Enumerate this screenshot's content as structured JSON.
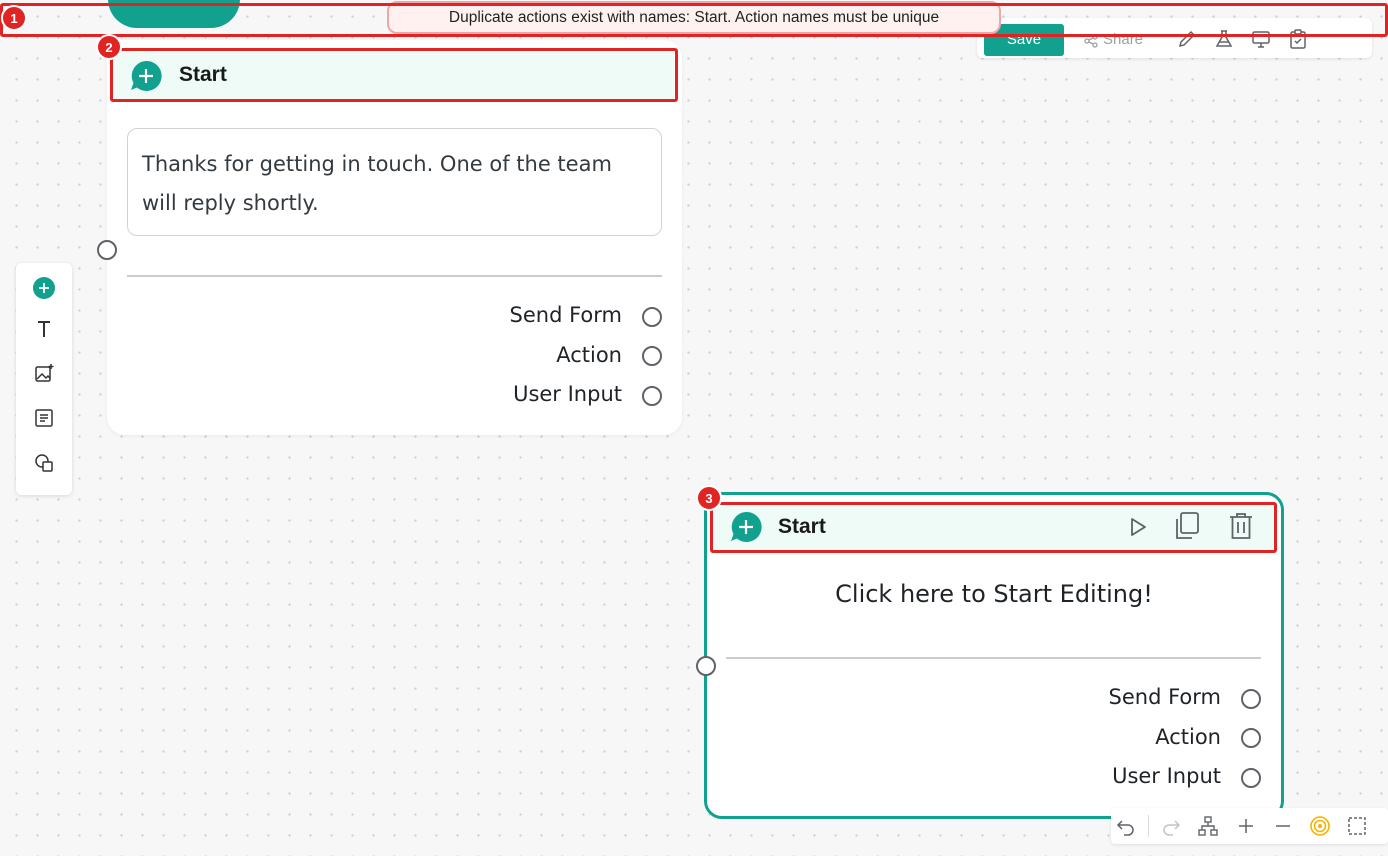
{
  "toast": {
    "message": "Duplicate actions exist with names: Start. Action names must be unique"
  },
  "toolbar": {
    "save_label": "Save",
    "share_label": "Share"
  },
  "annotations": [
    "1",
    "2",
    "3"
  ],
  "nodes": [
    {
      "title": "Start",
      "message": "Thanks for getting in touch. One of the team will reply shortly.",
      "ports": [
        "Send Form",
        "Action",
        "User Input"
      ]
    },
    {
      "title": "Start",
      "placeholder": "Click here to Start Editing!",
      "ports": [
        "Send Form",
        "Action",
        "User Input"
      ]
    }
  ],
  "colors": {
    "accent": "#12a18f",
    "annotation": "#e02424",
    "header_bg": "#eefbf6",
    "toast_bg": "#fff1f0"
  },
  "icons": {
    "rail": [
      "add-node-icon",
      "text-icon",
      "image-add-icon",
      "document-icon",
      "shapes-icon"
    ],
    "toolbar": [
      "pencil-icon",
      "flask-icon",
      "monitor-icon",
      "clipboard-icon"
    ],
    "node_actions": [
      "play-icon",
      "copy-icon",
      "trash-icon"
    ],
    "bottom": [
      "undo-icon",
      "redo-icon",
      "hierarchy-icon",
      "zoom-in-icon",
      "zoom-out-icon",
      "target-icon",
      "fit-view-icon"
    ]
  }
}
